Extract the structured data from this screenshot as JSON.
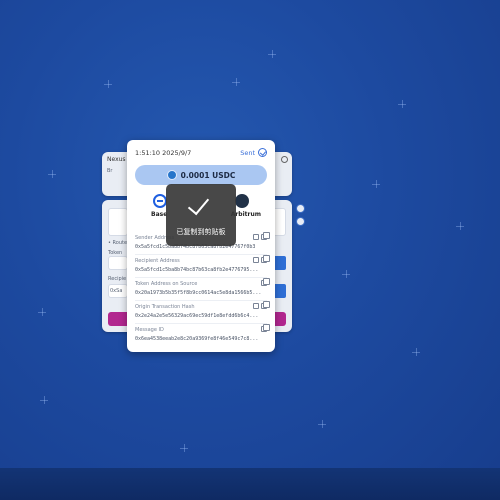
{
  "background": {
    "color": "#1d4aa0"
  },
  "back_window": {
    "top_text_1": "Nexus",
    "top_text_2": "Br",
    "left_label_1": "• Route",
    "token_label": "Token",
    "recipient_label": "Recipie",
    "recipient_value": "0xSa",
    "dest_fragment": "trum"
  },
  "modal": {
    "time": "1:51:10 2025/9/7",
    "status": "Sent",
    "amount": "0.0001 USDC",
    "source_chain": "Base",
    "dest_chain": "Arbitrum",
    "fields": [
      {
        "title": "Sender Address",
        "value": "0x5a5fcd1c5ba8b74bc87b63ca8fb2e47767f0b3"
      },
      {
        "title": "Recipient Address",
        "value": "0x5a5fcd1c5ba8b74bc87b63ca8fb2e4776795..."
      },
      {
        "title": "Token Address on Source",
        "value": "0x20a1973b5b35f5f8b9cc0614ac5e8da1566b5..."
      },
      {
        "title": "Origin Transaction Hash",
        "value": "0x2e24a2e5e56329ac69ec59df1e8efdd6b6c4..."
      },
      {
        "title": "Message ID",
        "value": "0x6ea4538eeab2e8c20a9369fe8f46e549c7c8..."
      }
    ]
  },
  "toast": {
    "text": "已复制到剪贴板"
  },
  "colors": {
    "accent": "#3a6fd8",
    "pill": "#aac7f2",
    "pink": "#b2278f",
    "toast_bg": "#383838"
  }
}
